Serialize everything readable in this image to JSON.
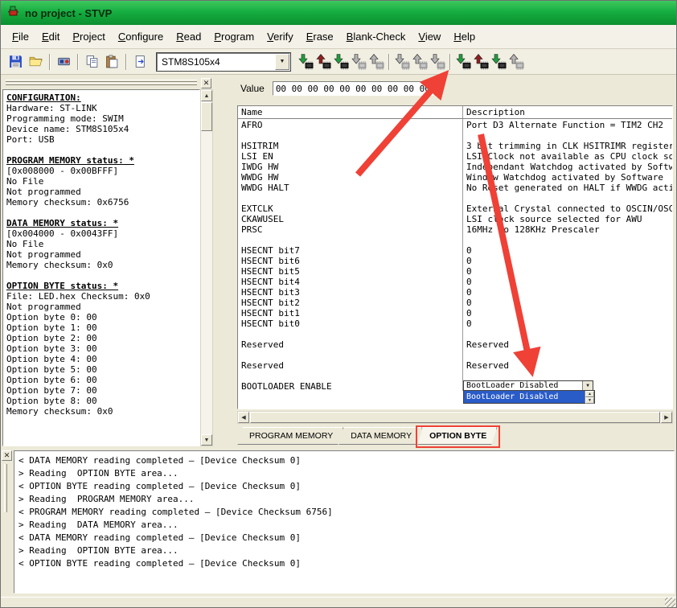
{
  "colors": {
    "title-green-light": "#3ec85e",
    "title-green": "#16ae41",
    "title-green-dark": "#0b8f2f",
    "highlight-blue": "#2a5cc8",
    "annotation-red": "#ef4136",
    "chip-green": "#1f9e3d",
    "chip-red": "#8f1f1f"
  },
  "window": {
    "title": "no project - STVP"
  },
  "menu": {
    "items": [
      "File",
      "Edit",
      "Project",
      "Configure",
      "Read",
      "Program",
      "Verify",
      "Erase",
      "Blank-Check",
      "View",
      "Help"
    ]
  },
  "toolbar": {
    "file_buttons": [
      {
        "name": "save-button",
        "icon": "floppy-icon"
      },
      {
        "name": "open-button",
        "icon": "folder-icon"
      },
      {
        "name": "configure-programmer-button",
        "icon": "programmer-icon"
      },
      {
        "name": "copy-button",
        "icon": "copy-icon"
      },
      {
        "name": "paste-button",
        "icon": "paste-icon"
      },
      {
        "name": "send-file-button",
        "icon": "page-icon"
      }
    ],
    "device_selector": {
      "value": "STM8S105x4"
    },
    "chip_buttons": [
      {
        "name": "program-current-tab-button",
        "arrow": "down",
        "tone": "green",
        "disabled": false
      },
      {
        "name": "read-current-tab-button",
        "arrow": "up",
        "tone": "red",
        "disabled": false
      },
      {
        "name": "verify-current-tab-button",
        "arrow": "down",
        "tone": "green",
        "disabled": false
      },
      {
        "name": "program-address-range-button",
        "arrow": "down",
        "tone": "gray",
        "disabled": true
      },
      {
        "name": "read-address-range-button",
        "arrow": "up",
        "tone": "gray",
        "disabled": true
      },
      {
        "sep": true
      },
      {
        "name": "program-all-button",
        "arrow": "down",
        "tone": "gray",
        "disabled": true
      },
      {
        "name": "read-all-button",
        "arrow": "up",
        "tone": "gray",
        "disabled": true
      },
      {
        "name": "verify-all-button",
        "arrow": "down",
        "tone": "gray",
        "disabled": true
      },
      {
        "sep": true
      },
      {
        "name": "program-device-button",
        "arrow": "down",
        "tone": "green",
        "disabled": false
      },
      {
        "name": "read-device-button",
        "arrow": "up",
        "tone": "red",
        "disabled": false
      },
      {
        "name": "verify-device-button",
        "arrow": "down",
        "tone": "green",
        "disabled": false
      },
      {
        "name": "erase-device-button",
        "arrow": "up",
        "tone": "gray",
        "disabled": true
      }
    ]
  },
  "left_panel": {
    "lines": [
      {
        "t": "CONFIGURATION:",
        "h": true
      },
      {
        "t": "Hardware: ST-LINK"
      },
      {
        "t": "Programming mode: SWIM"
      },
      {
        "t": "Device name: STM8S105x4"
      },
      {
        "t": "Port: USB"
      },
      {
        "t": ""
      },
      {
        "t": "PROGRAM MEMORY status: *",
        "h": true
      },
      {
        "t": "[0x008000 - 0x00BFFF]"
      },
      {
        "t": "No File"
      },
      {
        "t": "Not programmed"
      },
      {
        "t": "Memory checksum: 0x6756"
      },
      {
        "t": ""
      },
      {
        "t": "DATA MEMORY status: *",
        "h": true
      },
      {
        "t": "[0x004000 - 0x0043FF]"
      },
      {
        "t": "No File"
      },
      {
        "t": "Not programmed"
      },
      {
        "t": "Memory checksum: 0x0"
      },
      {
        "t": ""
      },
      {
        "t": "OPTION BYTE status: *",
        "h": true
      },
      {
        "t": "File: LED.hex Checksum: 0x0"
      },
      {
        "t": "Not programmed"
      },
      {
        "t": "Option byte 0: 00"
      },
      {
        "t": "Option byte 1: 00"
      },
      {
        "t": "Option byte 2: 00"
      },
      {
        "t": "Option byte 3: 00"
      },
      {
        "t": "Option byte 4: 00"
      },
      {
        "t": "Option byte 5: 00"
      },
      {
        "t": "Option byte 6: 00"
      },
      {
        "t": "Option byte 7: 00"
      },
      {
        "t": "Option byte 8: 00"
      },
      {
        "t": "Memory checksum: 0x0"
      }
    ]
  },
  "option_table": {
    "value_label": "Value",
    "value": "00 00 00 00 00 00 00 00 00 00",
    "columns": [
      "Name",
      "Description"
    ],
    "rows": [
      {
        "name": "AFRO",
        "desc": "Port D3 Alternate Function = TIM2_CH2"
      },
      {
        "spacer": true
      },
      {
        "name": "HSITRIM",
        "desc": "3 bit trimming in CLK_HSITRIMR register"
      },
      {
        "name": "LSI_EN",
        "desc": "LSI Clock not available as CPU clock source"
      },
      {
        "name": "IWDG_HW",
        "desc": "Independant Watchdog activated by Software"
      },
      {
        "name": "WWDG_HW",
        "desc": "Window Watchdog activated by Software"
      },
      {
        "name": "WWDG_HALT",
        "desc": "No Reset generated on HALT if WWDG active"
      },
      {
        "spacer": true
      },
      {
        "name": "EXTCLK",
        "desc": "External Crystal connected to OSCIN/OSCOUT"
      },
      {
        "name": "CKAWUSEL",
        "desc": "LSI clock source selected for AWU"
      },
      {
        "name": "PRSC",
        "desc": "16MHz to 128KHz Prescaler"
      },
      {
        "spacer": true
      },
      {
        "name": "HSECNT bit7",
        "desc": "0"
      },
      {
        "name": "HSECNT bit6",
        "desc": "0"
      },
      {
        "name": "HSECNT bit5",
        "desc": "0"
      },
      {
        "name": "HSECNT bit4",
        "desc": "0"
      },
      {
        "name": "HSECNT bit3",
        "desc": "0"
      },
      {
        "name": "HSECNT bit2",
        "desc": "0"
      },
      {
        "name": "HSECNT bit1",
        "desc": "0"
      },
      {
        "name": "HSECNT bit0",
        "desc": "0"
      },
      {
        "spacer": true
      },
      {
        "name": "Reserved",
        "desc": "Reserved"
      },
      {
        "spacer": true
      },
      {
        "name": "Reserved",
        "desc": "Reserved"
      },
      {
        "spacer": true
      },
      {
        "name": "BOOTLOADER ENABLE",
        "combo": true
      }
    ],
    "combo": {
      "selected": "BootLoader Disabled",
      "open_items": [
        "BootLoader Disabled"
      ],
      "highlight_index": 0
    }
  },
  "tabs": {
    "items": [
      "PROGRAM MEMORY",
      "DATA MEMORY",
      "OPTION BYTE"
    ],
    "active_index": 2
  },
  "log": {
    "lines": [
      "< DATA MEMORY reading completed — [Device Checksum 0]",
      "> Reading  OPTION BYTE area...",
      "< OPTION BYTE reading completed — [Device Checksum 0]",
      "> Reading  PROGRAM MEMORY area...",
      "< PROGRAM MEMORY reading completed — [Device Checksum 6756]",
      "> Reading  DATA MEMORY area...",
      "< DATA MEMORY reading completed — [Device Checksum 0]",
      "> Reading  OPTION BYTE area...",
      "< OPTION BYTE reading completed — [Device Checksum 0]"
    ]
  }
}
